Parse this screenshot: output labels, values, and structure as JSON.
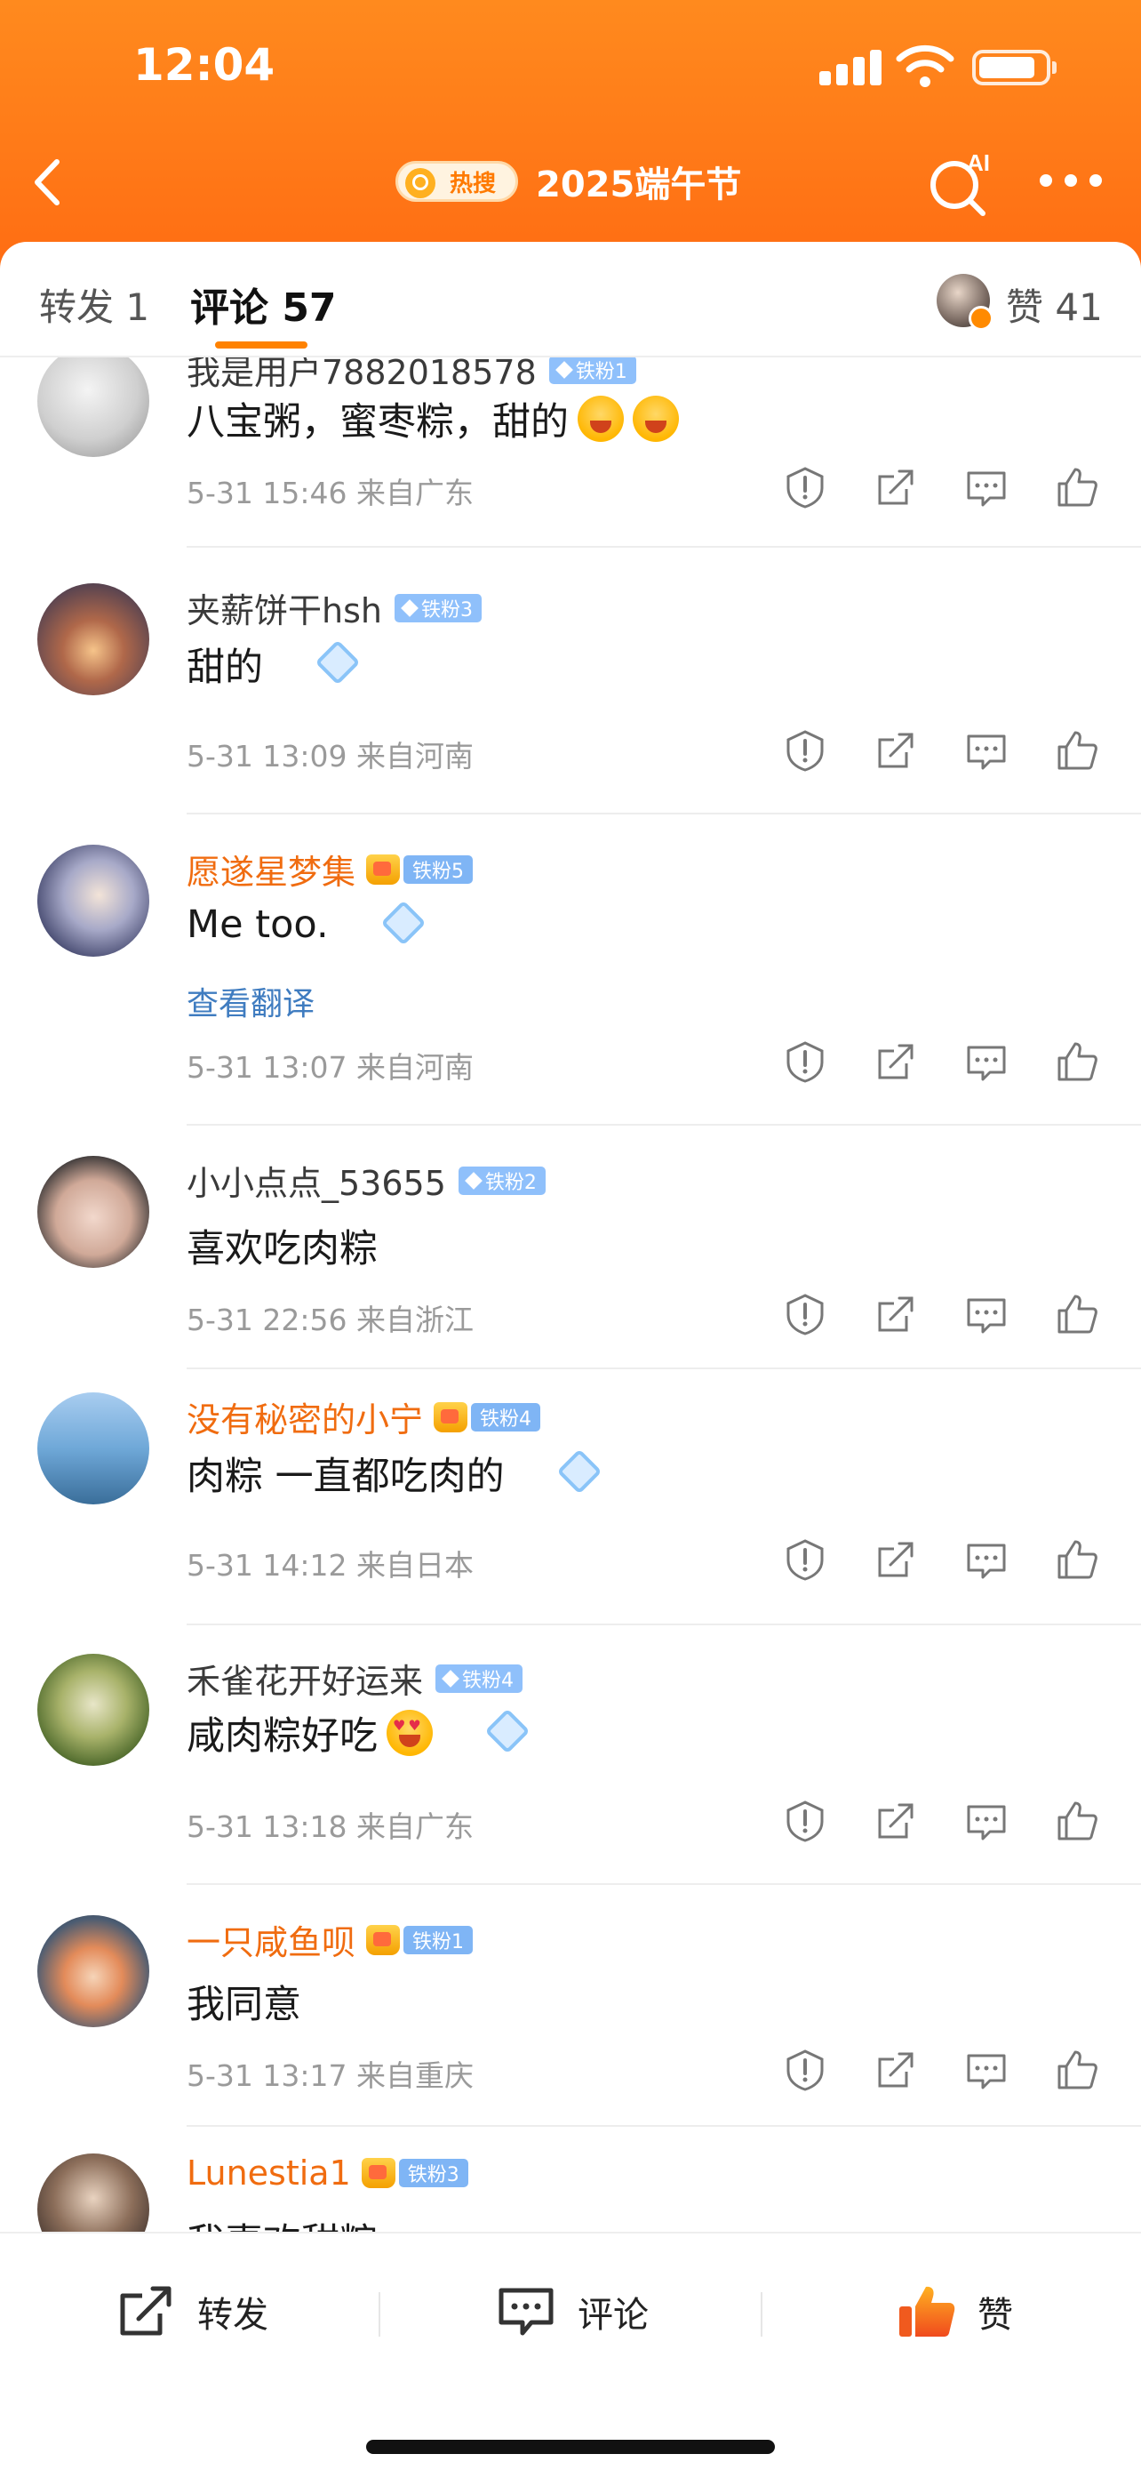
{
  "status_bar": {
    "time": "12:04"
  },
  "header": {
    "hot_badge": "热搜",
    "title": "2025端午节",
    "ai_label": "AI"
  },
  "tabs": {
    "repost": "转发 1",
    "comment": "评论 57",
    "likes": "赞 41"
  },
  "comments": [
    {
      "user": "我是用户7882018578",
      "badge": "铁粉1",
      "vip": false,
      "text": "八宝粥，蜜枣粽，甜的",
      "stickers": 2,
      "meta": "5-31 15:46 来自广东"
    },
    {
      "user": "夹薪饼干hsh",
      "badge": "铁粉3",
      "vip": false,
      "text": "甜的",
      "diamond": true,
      "meta": "5-31 13:09 来自河南"
    },
    {
      "user": "愿遂星梦集",
      "badge": "铁粉5",
      "vip": true,
      "text": "Me too.",
      "diamond": true,
      "translate": "查看翻译",
      "meta": "5-31 13:07 来自河南"
    },
    {
      "user": "小小点点_53655",
      "badge": "铁粉2",
      "vip": false,
      "text": "喜欢吃肉粽",
      "meta": "5-31 22:56 来自浙江"
    },
    {
      "user": "没有秘密的小宁",
      "badge": "铁粉4",
      "vip": true,
      "text": "肉粽 一直都吃肉的",
      "diamond": true,
      "meta": "5-31 14:12 来自日本"
    },
    {
      "user": "禾雀花开好运来",
      "badge": "铁粉4",
      "vip": false,
      "text": "咸肉粽好吃",
      "love": true,
      "diamond": true,
      "meta": "5-31 13:18 来自广东"
    },
    {
      "user": "一只咸鱼呗",
      "badge": "铁粉1",
      "vip": true,
      "text": "我同意",
      "meta": "5-31 13:17 来自重庆"
    },
    {
      "user": "Lunestia1",
      "badge": "铁粉3",
      "vip": true,
      "text": "我喜欢甜粽",
      "meta": ""
    }
  ],
  "bottom_bar": {
    "repost": "转发",
    "comment": "评论",
    "like": "赞"
  },
  "colors": {
    "brand_orange": "#ff7a18",
    "vip_name": "#f06c10",
    "fan_badge": "#8fc0fb",
    "link_blue": "#3f7cc0"
  }
}
